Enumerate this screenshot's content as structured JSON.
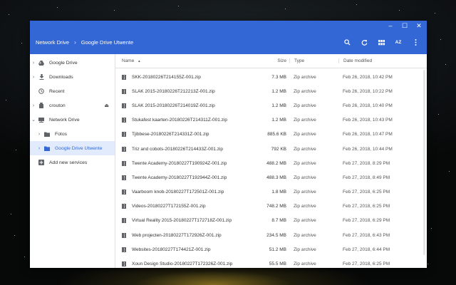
{
  "window_controls": {
    "minimize": "–",
    "maximize": "☐",
    "close": "✕"
  },
  "breadcrumb": {
    "items": [
      "Network Drive",
      "Google Drive Utwente"
    ],
    "separator": "›"
  },
  "toolbar": {
    "icons": [
      "search-icon",
      "refresh-icon",
      "grid-view-icon",
      "sort-icon",
      "more-vert-icon"
    ],
    "sort_label": "AZ"
  },
  "sidebar": {
    "items": [
      {
        "label": "Google Drive",
        "icon": "drive-icon",
        "expandable": true
      },
      {
        "label": "Downloads",
        "icon": "download-icon",
        "expandable": true
      },
      {
        "label": "Recent",
        "icon": "clock-icon",
        "expandable": false
      },
      {
        "label": "crouton",
        "icon": "usb-icon",
        "expandable": true,
        "eject": "⏏"
      },
      {
        "label": "Network Drive",
        "icon": "network-drive-icon",
        "expandable": true,
        "expanded": true
      },
      {
        "label": "Fotos",
        "icon": "folder-icon",
        "expandable": true,
        "indent": 1
      },
      {
        "label": "Google Drive Utwente",
        "icon": "folder-icon",
        "expandable": true,
        "indent": 1,
        "selected": true
      },
      {
        "label": "Add new services",
        "icon": "add-services-icon",
        "expandable": false
      }
    ]
  },
  "table": {
    "columns": {
      "name": "Name",
      "sort_arrow": "▲",
      "size": "Size",
      "type": "Type",
      "date": "Date modified"
    },
    "rows": [
      {
        "name": "SKK-20180226T214155Z-001.zip",
        "size": "7.3 MB",
        "type": "Zip archive",
        "date": "Feb 26, 2018, 10:42 PM"
      },
      {
        "name": "SLAK 2015-20180226T212213Z-001.zip",
        "size": "1.2 MB",
        "type": "Zip archive",
        "date": "Feb 26, 2018, 10:22 PM"
      },
      {
        "name": "SLAK 2015-20180226T214019Z-001.zip",
        "size": "1.2 MB",
        "type": "Zip archive",
        "date": "Feb 26, 2018, 10:40 PM"
      },
      {
        "name": "Stukafest kaarten-20180226T214311Z-001.zip",
        "size": "1.2 MB",
        "type": "Zip archive",
        "date": "Feb 26, 2018, 10:43 PM"
      },
      {
        "name": "Tjibbese-20180226T214331Z-001.zip",
        "size": "885.6 KB",
        "type": "Zip archive",
        "date": "Feb 26, 2018, 10:47 PM"
      },
      {
        "name": "Triz and cobots-20180226T214433Z-001.zip",
        "size": "792 KB",
        "type": "Zip archive",
        "date": "Feb 26, 2018, 10:44 PM"
      },
      {
        "name": "Twente Academy-20180227T190924Z-001.zip",
        "size": "488.2 MB",
        "type": "Zip archive",
        "date": "Feb 27, 2018, 8:29 PM"
      },
      {
        "name": "Twente Academy-20180227T192944Z-001.zip",
        "size": "488.3 MB",
        "type": "Zip archive",
        "date": "Feb 27, 2018, 8:49 PM"
      },
      {
        "name": "Vaarboom knob-20180227T172501Z-001.zip",
        "size": "1.8 MB",
        "type": "Zip archive",
        "date": "Feb 27, 2018, 6:25 PM"
      },
      {
        "name": "Videos-20180227T172155Z-001.zip",
        "size": "748.2 MB",
        "type": "Zip archive",
        "date": "Feb 27, 2018, 6:25 PM"
      },
      {
        "name": "Virtual Reality 2015-20180227T172718Z-001.zip",
        "size": "8.7 MB",
        "type": "Zip archive",
        "date": "Feb 27, 2018, 6:29 PM"
      },
      {
        "name": "Web projecten-20180227T172926Z-001.zip",
        "size": "234.5 MB",
        "type": "Zip archive",
        "date": "Feb 27, 2018, 6:43 PM"
      },
      {
        "name": "Websites-20180227T174421Z-001.zip",
        "size": "51.2 MB",
        "type": "Zip archive",
        "date": "Feb 27, 2018, 6:44 PM"
      },
      {
        "name": "Xoun Design Studio-20180227T172326Z-001.zip",
        "size": "55.5 MB",
        "type": "Zip archive",
        "date": "Feb 27, 2018, 6:25 PM"
      }
    ]
  },
  "colors": {
    "accent": "#3367d6",
    "selected_bg": "#e1ebfb"
  }
}
